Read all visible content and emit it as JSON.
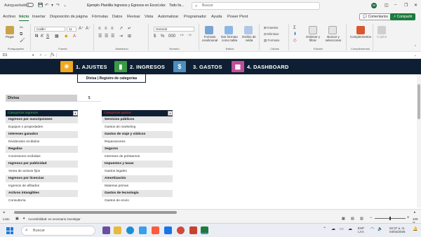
{
  "titlebar": {
    "autosave_label": "Autoguardado",
    "document_name": "Ejemplo Plantilla Ingresos y Egresos en Excel.xlsx",
    "sensitivity": "Todo lis...",
    "search_placeholder": "Buscar",
    "user_initials": "SR"
  },
  "menu": {
    "tabs": [
      "Archivo",
      "Inicio",
      "Insertar",
      "Disposición de página",
      "Fórmulas",
      "Datos",
      "Revisar",
      "Vista",
      "Automatizar",
      "Programador",
      "Ayuda",
      "Power Pivot"
    ],
    "active_tab": "Inicio",
    "comments_label": "Comentarios",
    "share_label": "Compartir"
  },
  "ribbon": {
    "clipboard": {
      "paste_label": "Pegar",
      "group_label": "Portapapeles"
    },
    "font": {
      "font_name": "Calibri",
      "font_size": "11",
      "group_label": "Fuente"
    },
    "alignment": {
      "group_label": "Alineación"
    },
    "number": {
      "format": "General",
      "group_label": "Número"
    },
    "styles": {
      "conditional_format": "Formato condicional",
      "table_format": "Dar formato como tabla",
      "cell_styles": "Estilos de celda",
      "group_label": "Estilos"
    },
    "cells": {
      "insert": "Insertar",
      "delete": "Eliminar",
      "format": "Formato",
      "group_label": "Celdas"
    },
    "editing": {
      "sort_filter": "Ordenar y filtrar",
      "find_select": "Buscar y seleccionar",
      "group_label": "Edición"
    },
    "addins": {
      "complements": "Complementos",
      "group_label": "Complementos"
    },
    "copilot": {
      "label": "Copilot"
    }
  },
  "formula_bar": {
    "name_box": "D1",
    "fx": "fx",
    "content": ""
  },
  "navigation": {
    "items": [
      {
        "label": "1. AJUSTES",
        "icon": "gear-icon",
        "color": "#f2a81d"
      },
      {
        "label": "2. INGRESOS",
        "icon": "money-chart-icon",
        "color": "#3a9a45"
      },
      {
        "label": "3. GASTOS",
        "icon": "dollar-doc-icon",
        "color": "#4a8fbe"
      },
      {
        "label": "4. DASHBOARD",
        "icon": "dashboard-icon",
        "color": "#c04e9a"
      }
    ],
    "subtab": "Divisa | Registro de categorías"
  },
  "divisa": {
    "label": "Divisa",
    "value": "$"
  },
  "income_categories": {
    "header": "Categorías ingresos",
    "header_color": "#3fbf5a",
    "items": [
      "Ingresos por suscripciones",
      "Equipos o propiedades",
      "Intereses ganados",
      "Dividendos recibidos",
      "Regalías",
      "Comisiones recibidas",
      "Ingresos por publicidad",
      "Venta de activos fijos",
      "Ingresos por licencias",
      "Ingresos de afiliados",
      "Activos intangibles",
      "Consultoría"
    ]
  },
  "expense_categories": {
    "header": "Categorías gastos",
    "header_color": "#e03a3a",
    "items": [
      "Servicios públicos",
      "Gastos de marketing",
      "Gastos de viaje y viáticos",
      "Reparaciones",
      "Seguros",
      "Intereses de préstamos",
      "Impuestos y tasas",
      "Gastos legales",
      "Amortización",
      "Materias primas",
      "Gastos de tecnología",
      "Gastos de envío"
    ]
  },
  "status_bar": {
    "ready": "Listo",
    "accessibility": "Accesibilidad: es necesario investigar",
    "zoom": "100 %"
  },
  "taskbar": {
    "search_placeholder": "Buscar",
    "language": "ESP",
    "language_sub": "LAA",
    "time": "02:37 a. m.",
    "date": "04/04/2025"
  }
}
